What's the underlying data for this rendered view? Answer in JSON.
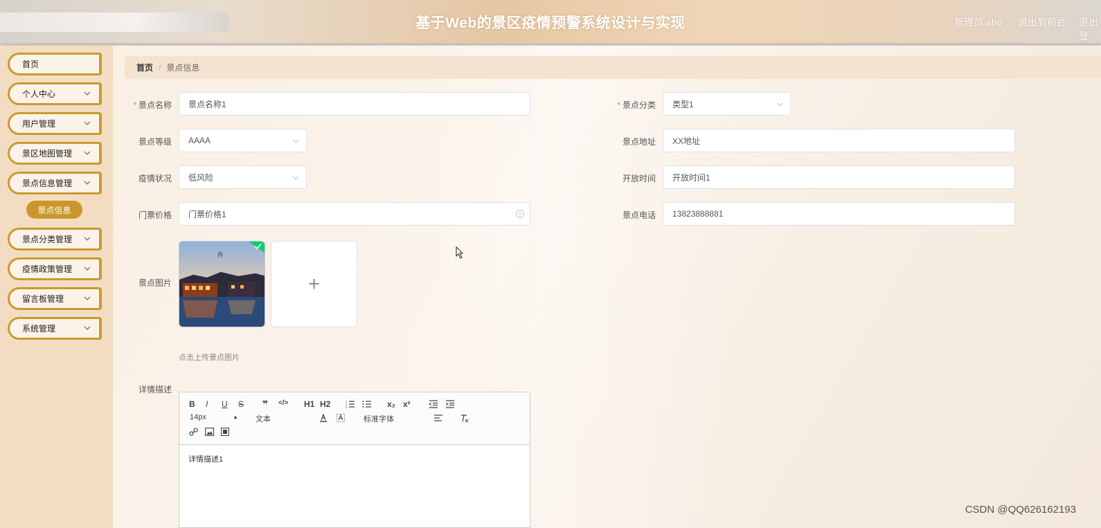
{
  "header": {
    "title": "基于Web的景区疫情预警系统设计与实现",
    "admin_label": "管理员 abo",
    "exit_front": "退出到前台",
    "exit_system": "退出登"
  },
  "sidebar": {
    "items": [
      {
        "label": "首页",
        "chevron": false
      },
      {
        "label": "个人中心",
        "chevron": true
      },
      {
        "label": "用户管理",
        "chevron": true
      },
      {
        "label": "景区地图管理",
        "chevron": true
      },
      {
        "label": "景点信息管理",
        "chevron": true
      },
      {
        "label": "景点分类管理",
        "chevron": true
      },
      {
        "label": "疫情政策管理",
        "chevron": true
      },
      {
        "label": "留言板管理",
        "chevron": true
      },
      {
        "label": "系统管理",
        "chevron": true
      }
    ],
    "active_sub": "景点信息"
  },
  "breadcrumb": {
    "home": "首页",
    "separator": "/",
    "current": "景点信息"
  },
  "form": {
    "name": {
      "label": "景点名称",
      "value": "景点名称1",
      "required": true
    },
    "category": {
      "label": "景点分类",
      "value": "类型1",
      "required": true
    },
    "level": {
      "label": "景点等级",
      "value": "AAAA"
    },
    "address": {
      "label": "景点地址",
      "value": "XX地址"
    },
    "status": {
      "label": "疫情状况",
      "value": "低风险"
    },
    "open_time": {
      "label": "开放时间",
      "value": "开放时间1"
    },
    "price": {
      "label": "门票价格",
      "value": "门票价格1"
    },
    "phone": {
      "label": "景点电话",
      "value": "13823888881"
    },
    "image": {
      "label": "景点图片",
      "upload_tip": "点击上传景点图片",
      "add_symbol": "+"
    },
    "description": {
      "label": "详情描述",
      "value": "详情描述1"
    }
  },
  "editor": {
    "font_size": "14px",
    "block_type": "文本",
    "font_family": "标准字体",
    "tools_row1": [
      "B",
      "I",
      "U",
      "S",
      "❞",
      "</>",
      "H1",
      "H2",
      "ol",
      "ul",
      "x₂",
      "x²",
      "outdent",
      "indent"
    ]
  },
  "colors": {
    "accent": "#c99a2e",
    "sidebar_bg": "#f3ddc2",
    "breadcrumb_bg": "#f4e3d0",
    "required": "#f56c6c",
    "success": "#13ce66"
  },
  "watermark": "CSDN @QQ626162193"
}
